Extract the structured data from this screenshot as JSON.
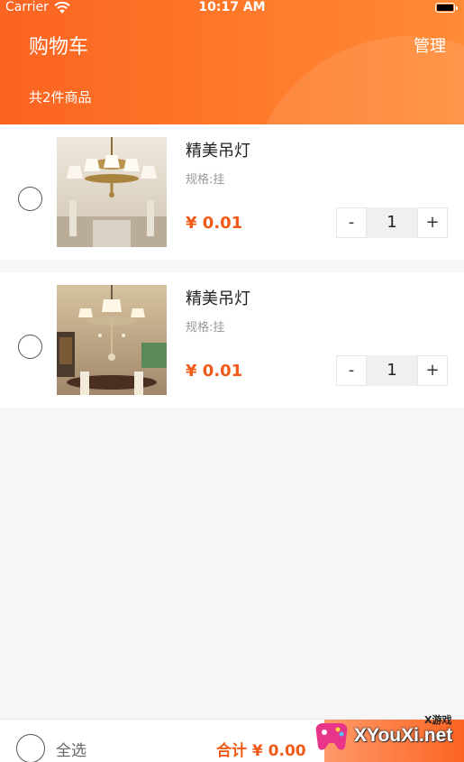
{
  "status_bar": {
    "carrier": "Carrier",
    "time": "10:17 AM"
  },
  "header": {
    "title": "购物车",
    "manage_label": "管理",
    "count_label": "共2件商品",
    "gradient_colors": [
      "#fb6321",
      "#ff8a36"
    ]
  },
  "cart": {
    "items": [
      {
        "name": "精美吊灯",
        "spec": "规格:挂",
        "price": "¥ 0.01",
        "quantity": "1",
        "minus_label": "-",
        "plus_label": "+",
        "image_icon": "chandelier-photo"
      },
      {
        "name": "精美吊灯",
        "spec": "规格:挂",
        "price": "¥ 0.01",
        "quantity": "1",
        "minus_label": "-",
        "plus_label": "+",
        "image_icon": "chandelier-photo"
      }
    ]
  },
  "bottom_bar": {
    "select_all_label": "全选",
    "total_label": "合计 ¥ 0.00"
  },
  "watermark": {
    "small_text": "X游戏",
    "big_text": "XYouXi.net"
  },
  "colors": {
    "accent": "#f05a16",
    "background": "#f6f6f6"
  }
}
